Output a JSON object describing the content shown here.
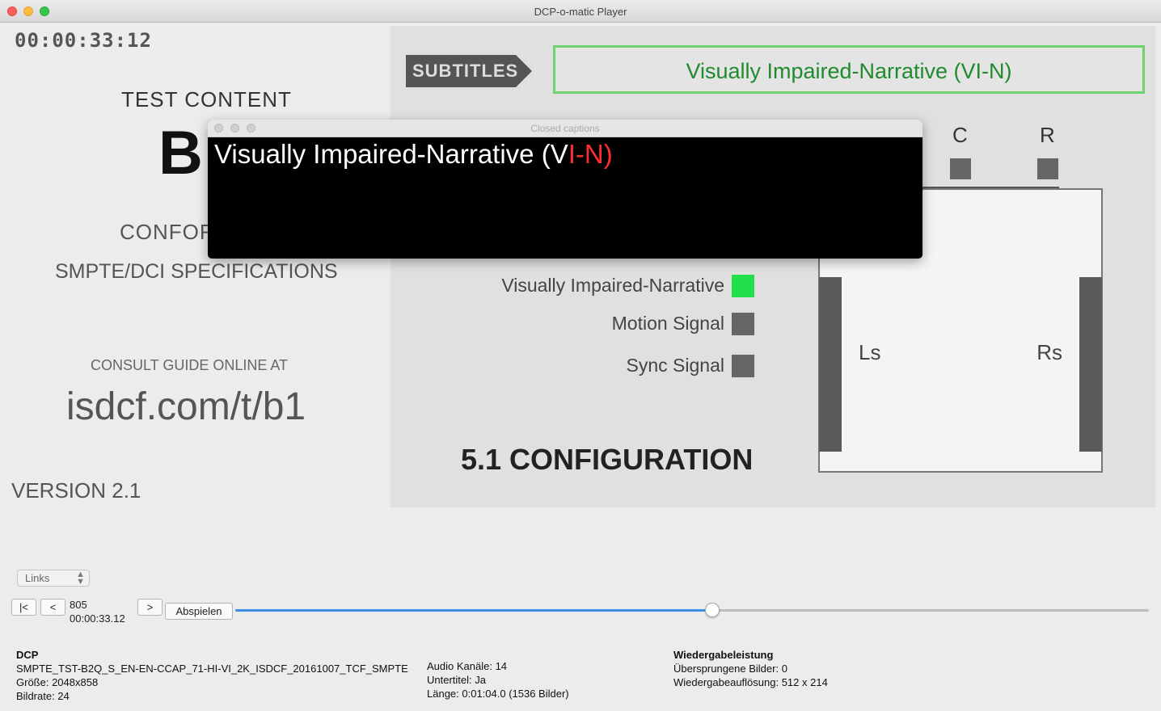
{
  "window": {
    "title": "DCP-o-matic Player"
  },
  "video": {
    "timecode": "00:00:33:12",
    "test_content": "TEST CONTENT",
    "big_letter": "B",
    "conform_partial": "CONFOR",
    "spec_line": "SMPTE/DCI SPECIFICATIONS",
    "consult": "CONSULT GUIDE ONLINE AT",
    "url": "isdcf.com/t/b1",
    "version": "VERSION 2.1",
    "subtitles_tag": "SUBTITLES",
    "subtitle_text": "Visually Impaired-Narrative (VI-N)",
    "channels": {
      "c": "C",
      "r": "R",
      "ls": "Ls",
      "rs": "Rs"
    },
    "signals": [
      {
        "label": "Visually Impaired-Narrative",
        "color": "#22e04a"
      },
      {
        "label": "Motion Signal",
        "color": "#666666"
      },
      {
        "label": "Sync Signal",
        "color": "#666666"
      }
    ],
    "configuration": "5.1 CONFIGURATION"
  },
  "captions_window": {
    "title": "Closed captions",
    "text_white": "Visually Impaired-Narrative (V",
    "text_red": "I-N)"
  },
  "controls": {
    "eye_select": "Links",
    "btn_start": "|<",
    "btn_back": "<",
    "btn_forward": ">",
    "btn_play": "Abspielen",
    "frame": "805",
    "time": "00:00:33.12",
    "position_fraction": 0.522
  },
  "info": {
    "dcp_heading": "DCP",
    "dcp_name": "SMPTE_TST-B2Q_S_EN-EN-CCAP_71-HI-VI_2K_ISDCF_20161007_TCF_SMPTE",
    "size": "Größe: 2048x858",
    "framerate": "Bildrate: 24",
    "audio_channels": "Audio Kanäle: 14",
    "subtitles": "Untertitel: Ja",
    "length": "Länge: 0:01:04.0 (1536 Bilder)",
    "perf_heading": "Wiedergabeleistung",
    "dropped": "Übersprungene Bilder: 0",
    "resolution": "Wiedergabeauflösung: 512 x 214"
  }
}
